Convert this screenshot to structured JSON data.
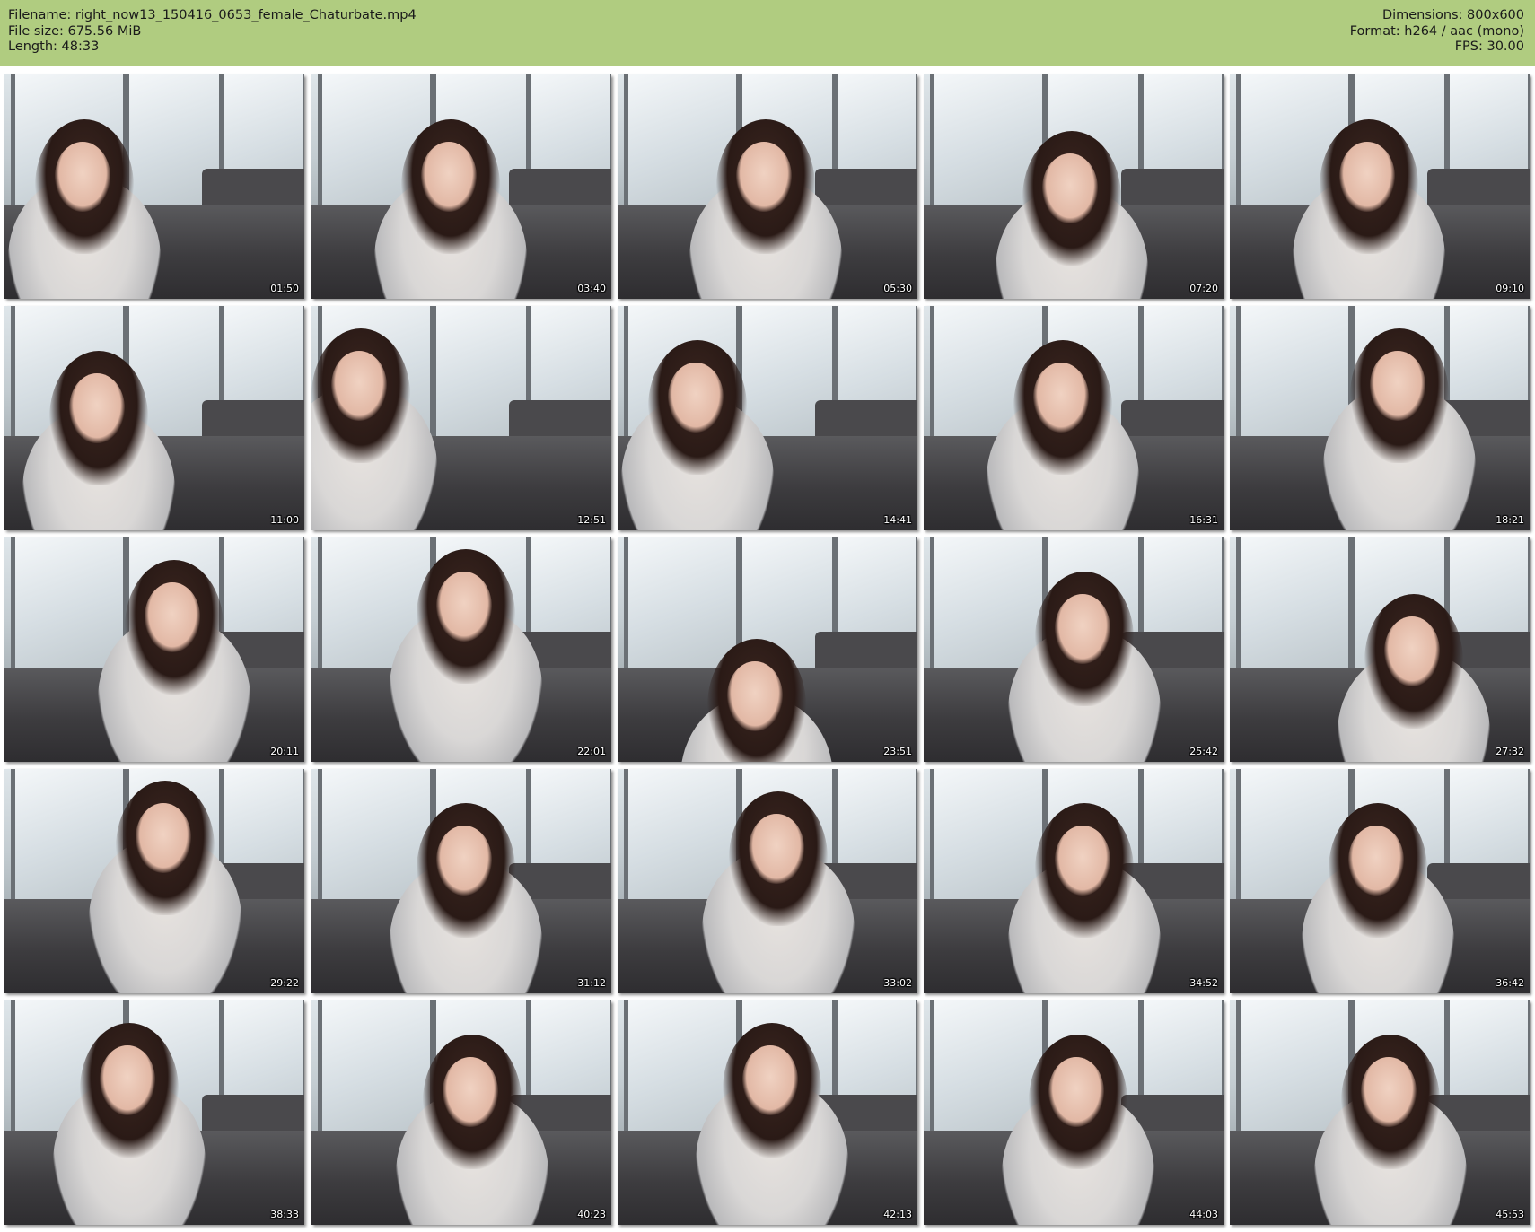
{
  "header": {
    "filename": "Filename: right_now13_150416_0653_female_Chaturbate.mp4",
    "filesize": "File size: 675.56 MiB",
    "length": "Length: 48:33",
    "dimensions": "Dimensions: 800x600",
    "format": "Format: h264 / aac (mono)",
    "fps": "FPS: 30.00"
  },
  "colors": {
    "header_bg": "#b0cc80",
    "page_bg": "#ffffff"
  },
  "thumbnails": [
    {
      "timestamp": "01:50"
    },
    {
      "timestamp": "03:40"
    },
    {
      "timestamp": "05:30"
    },
    {
      "timestamp": "07:20"
    },
    {
      "timestamp": "09:10"
    },
    {
      "timestamp": "11:00"
    },
    {
      "timestamp": "12:51"
    },
    {
      "timestamp": "14:41"
    },
    {
      "timestamp": "16:31"
    },
    {
      "timestamp": "18:21"
    },
    {
      "timestamp": "20:11"
    },
    {
      "timestamp": "22:01"
    },
    {
      "timestamp": "23:51"
    },
    {
      "timestamp": "25:42"
    },
    {
      "timestamp": "27:32"
    },
    {
      "timestamp": "29:22"
    },
    {
      "timestamp": "31:12"
    },
    {
      "timestamp": "33:02"
    },
    {
      "timestamp": "34:52"
    },
    {
      "timestamp": "36:42"
    },
    {
      "timestamp": "38:33"
    },
    {
      "timestamp": "40:23"
    },
    {
      "timestamp": "42:13"
    },
    {
      "timestamp": "44:03"
    },
    {
      "timestamp": "45:53"
    }
  ]
}
